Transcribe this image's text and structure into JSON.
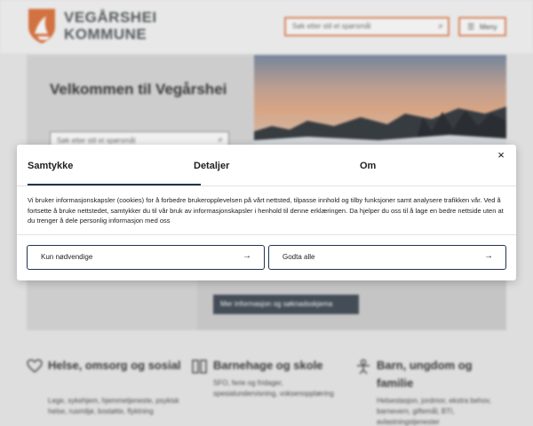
{
  "site": {
    "logo_line1": "VEGÅRSHEI",
    "logo_line2": "KOMMUNE",
    "search_placeholder": "Søk etter stil et spørsmål",
    "menu_label": "Meny",
    "icons": {
      "search": "search-icon",
      "menu": "menu-icon"
    }
  },
  "hero": {
    "title": "Velkommen til Vegårshei",
    "search_placeholder": "Søk etter stil et spørsmål",
    "info_button": "Mer informasjon og søknadsskjema"
  },
  "categories": [
    {
      "title": "Helse, omsorg og sosial",
      "desc": "Lege, sykehjem, hjemmetjeneste, psykisk helse, rusmiljø, bostøtte, flyktning",
      "icon": "heart-hands-icon"
    },
    {
      "title": "Barnehage og skole",
      "desc": "SFO, ferie og fridager, spesialundervisning, voksenopplæring",
      "icon": "children-icon"
    },
    {
      "title": "Barn, ungdom og familie",
      "desc": "Helsestasjon, jordmor, ekstra behov, barnevern, giftemål, BTI, avlastningstjenester",
      "icon": "family-icon"
    }
  ],
  "cookie_dialog": {
    "tabs": [
      "Samtykke",
      "Detaljer",
      "Om"
    ],
    "active_tab": "Samtykke",
    "close_label": "×",
    "text": "Vi bruker informasjonskapsler (cookies) for å forbedre brukeropplevelsen på vårt nettsted, tilpasse innhold og tilby funksjoner samt analysere trafikken vår. Ved å fortsette å bruke nettstedet, samtykker du til vår bruk av informasjonskapsler i henhold til denne erklæringen. Da hjelper du oss til å lage en bedre nettside uten at du trenger å dele personlig informasjon med oss",
    "buttons": [
      {
        "label": "Kun nødvendige",
        "arrow": "→"
      },
      {
        "label": "Godta alle",
        "arrow": "→"
      }
    ]
  },
  "colors": {
    "brand_orange": "#e58d63",
    "dialog_accent": "#1f3550",
    "info_button_bg": "#49525d"
  }
}
